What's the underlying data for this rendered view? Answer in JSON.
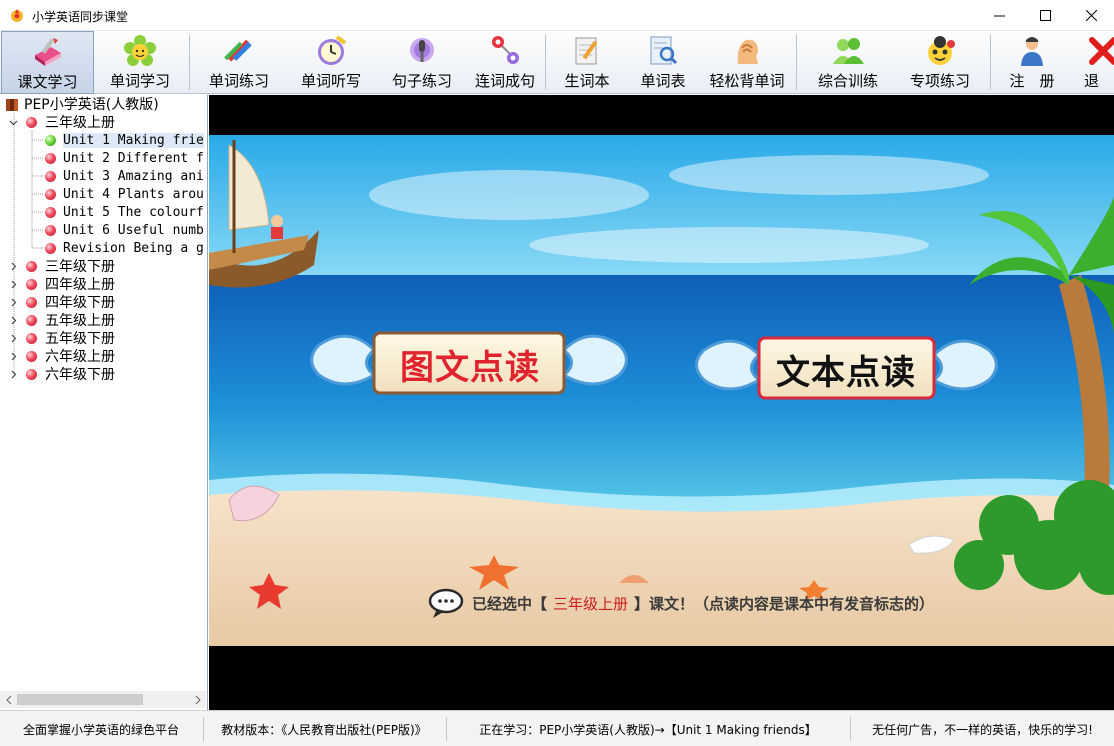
{
  "window": {
    "title": "小学英语同步课堂",
    "controls": {
      "minimize": "minimize",
      "maximize": "maximize",
      "close": "close"
    }
  },
  "toolbar": {
    "buttons": [
      {
        "label": "课文学习",
        "icon": "book-icon",
        "active": true
      },
      {
        "label": "单词学习",
        "icon": "flower-icon"
      },
      {
        "label": "单词练习",
        "icon": "pencils-icon"
      },
      {
        "label": "单词听写",
        "icon": "clock-icon"
      },
      {
        "label": "句子练习",
        "icon": "microphone-icon"
      },
      {
        "label": "连词成句",
        "icon": "link-nodes-icon"
      },
      {
        "label": "生词本",
        "icon": "notebook-icon"
      },
      {
        "label": "单词表",
        "icon": "search-list-icon"
      },
      {
        "label": "轻松背单词",
        "icon": "head-icon"
      },
      {
        "label": "综合训练",
        "icon": "people-icon"
      },
      {
        "label": "专项练习",
        "icon": "ladybug-icon"
      },
      {
        "label": "注　册",
        "icon": "user-icon"
      },
      {
        "label": "退",
        "icon": "exit-icon"
      }
    ]
  },
  "tree": {
    "root": "PEP小学英语(人教版)",
    "grades": [
      {
        "label": "三年级上册",
        "expanded": true,
        "units": [
          {
            "label": "Unit 1 Making frie",
            "selected": true
          },
          {
            "label": "Unit 2 Different f"
          },
          {
            "label": "Unit 3 Amazing ani"
          },
          {
            "label": "Unit 4 Plants arou"
          },
          {
            "label": "Unit 5 The colourf"
          },
          {
            "label": "Unit 6 Useful numb"
          },
          {
            "label": "Revision Being a g"
          }
        ]
      },
      {
        "label": "三年级下册"
      },
      {
        "label": "四年级上册"
      },
      {
        "label": "四年级下册"
      },
      {
        "label": "五年级上册"
      },
      {
        "label": "五年级下册"
      },
      {
        "label": "六年级上册"
      },
      {
        "label": "六年级下册"
      }
    ]
  },
  "main": {
    "picture_read_label": "图文点读",
    "text_read_label": "文本点读",
    "hint": {
      "prefix": "已经选中【",
      "grade": "三年级上册",
      "suffix": "】课文！（点读内容是课本中有发音标志的）"
    }
  },
  "status": {
    "slogan": "全面掌握小学英语的绿色平台",
    "edition": "教材版本：《人民教育出版社(PEP版)》",
    "learning": "正在学习：PEP小学英语(人教版)→【Unit 1 Making friends】",
    "ad": "无任何广告，不一样的英语，快乐的学习!"
  },
  "colors": {
    "toolbar_bg": "#e9eef5",
    "sky": "#56c6f0",
    "sea": "#1b74c4",
    "sand": "#efd9bd",
    "scroll_red_text": "#e0232d",
    "scroll_dark_text": "#111111"
  }
}
